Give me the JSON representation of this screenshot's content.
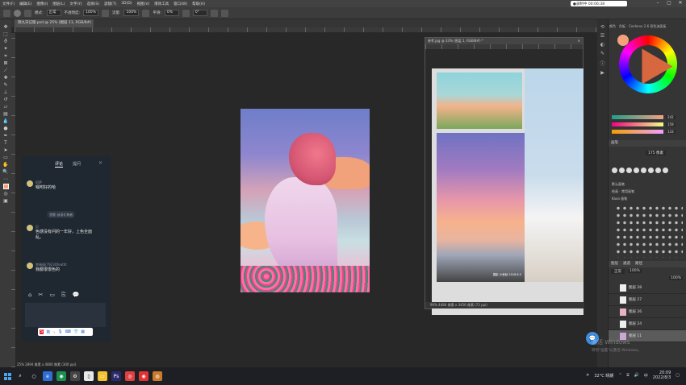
{
  "menu": [
    "文件(F)",
    "编辑(E)",
    "图像(I)",
    "图层(L)",
    "文字(Y)",
    "选择(S)",
    "滤镜(T)",
    "3D(D)",
    "视图(V)",
    "增效工具",
    "窗口(W)",
    "帮助(H)"
  ],
  "recording": {
    "label": "●录制中 00:06:38"
  },
  "options": {
    "mode_label": "模式:",
    "mode": "正常",
    "opacity_label": "不透明度:",
    "opacity": "100%",
    "flow_label": "流量:",
    "flow": "100%",
    "smooth_label": "平滑:",
    "smooth": "0%",
    "angle": "0°"
  },
  "document_tab": "阴九日记版.psd @ 25% (图层 11, RGB/8#)",
  "chat": {
    "tabs": [
      "评论",
      "提问"
    ],
    "messages": [
      {
        "name": "阿萨",
        "text": "嘱咐好的哈"
      },
      {
        "name": "贝",
        "text": "色感没有问的一年好，上色全面乱。"
      },
      {
        "name": "幸福调(7923Qfeatht",
        "text": "我都很很色的"
      }
    ],
    "gift": "答题 谜语礼物者",
    "tools": [
      "⌂",
      "✂",
      "▭",
      "⎘",
      "💬"
    ]
  },
  "reference_window": {
    "title": "参考.jpg @ 33% (图层 1, RGB/8#) *",
    "status": "90%    4484 像素 x 3456 像素 (72 ppi)",
    "caption": "摄影 小秋秋 2018.8.5"
  },
  "right_panel": {
    "tabs": [
      "颜色",
      "色板",
      "Coolorus 2.6 双色流面板"
    ],
    "color_values": [
      "242",
      "159",
      "133"
    ],
    "brush_section": "画笔",
    "brush_size": "175 像素",
    "brush_items": [
      "默认画笔",
      "绘画 - 常用画笔",
      "Kaxa 画笔"
    ],
    "layers_tabs": [
      "图层",
      "通道",
      "路径"
    ],
    "layer_mode": "正常",
    "layer_opacity": "100%",
    "fill": "100%",
    "layers": [
      "图层 28",
      "图层 27",
      "图层 26",
      "图层 24",
      "图层 11"
    ]
  },
  "status_bar": "25%    2894 像素 x 4800 像素 (300 ppi)",
  "watermark": [
    "激活 Windows",
    "转到\"设置\"以激活 Windows。"
  ],
  "taskbar": {
    "weather": "32°C 晴朗",
    "time": "20:09",
    "date": "2022/8/3"
  },
  "colors": {
    "accent": "#f2a27a",
    "chat_bg": "#1f2730"
  }
}
